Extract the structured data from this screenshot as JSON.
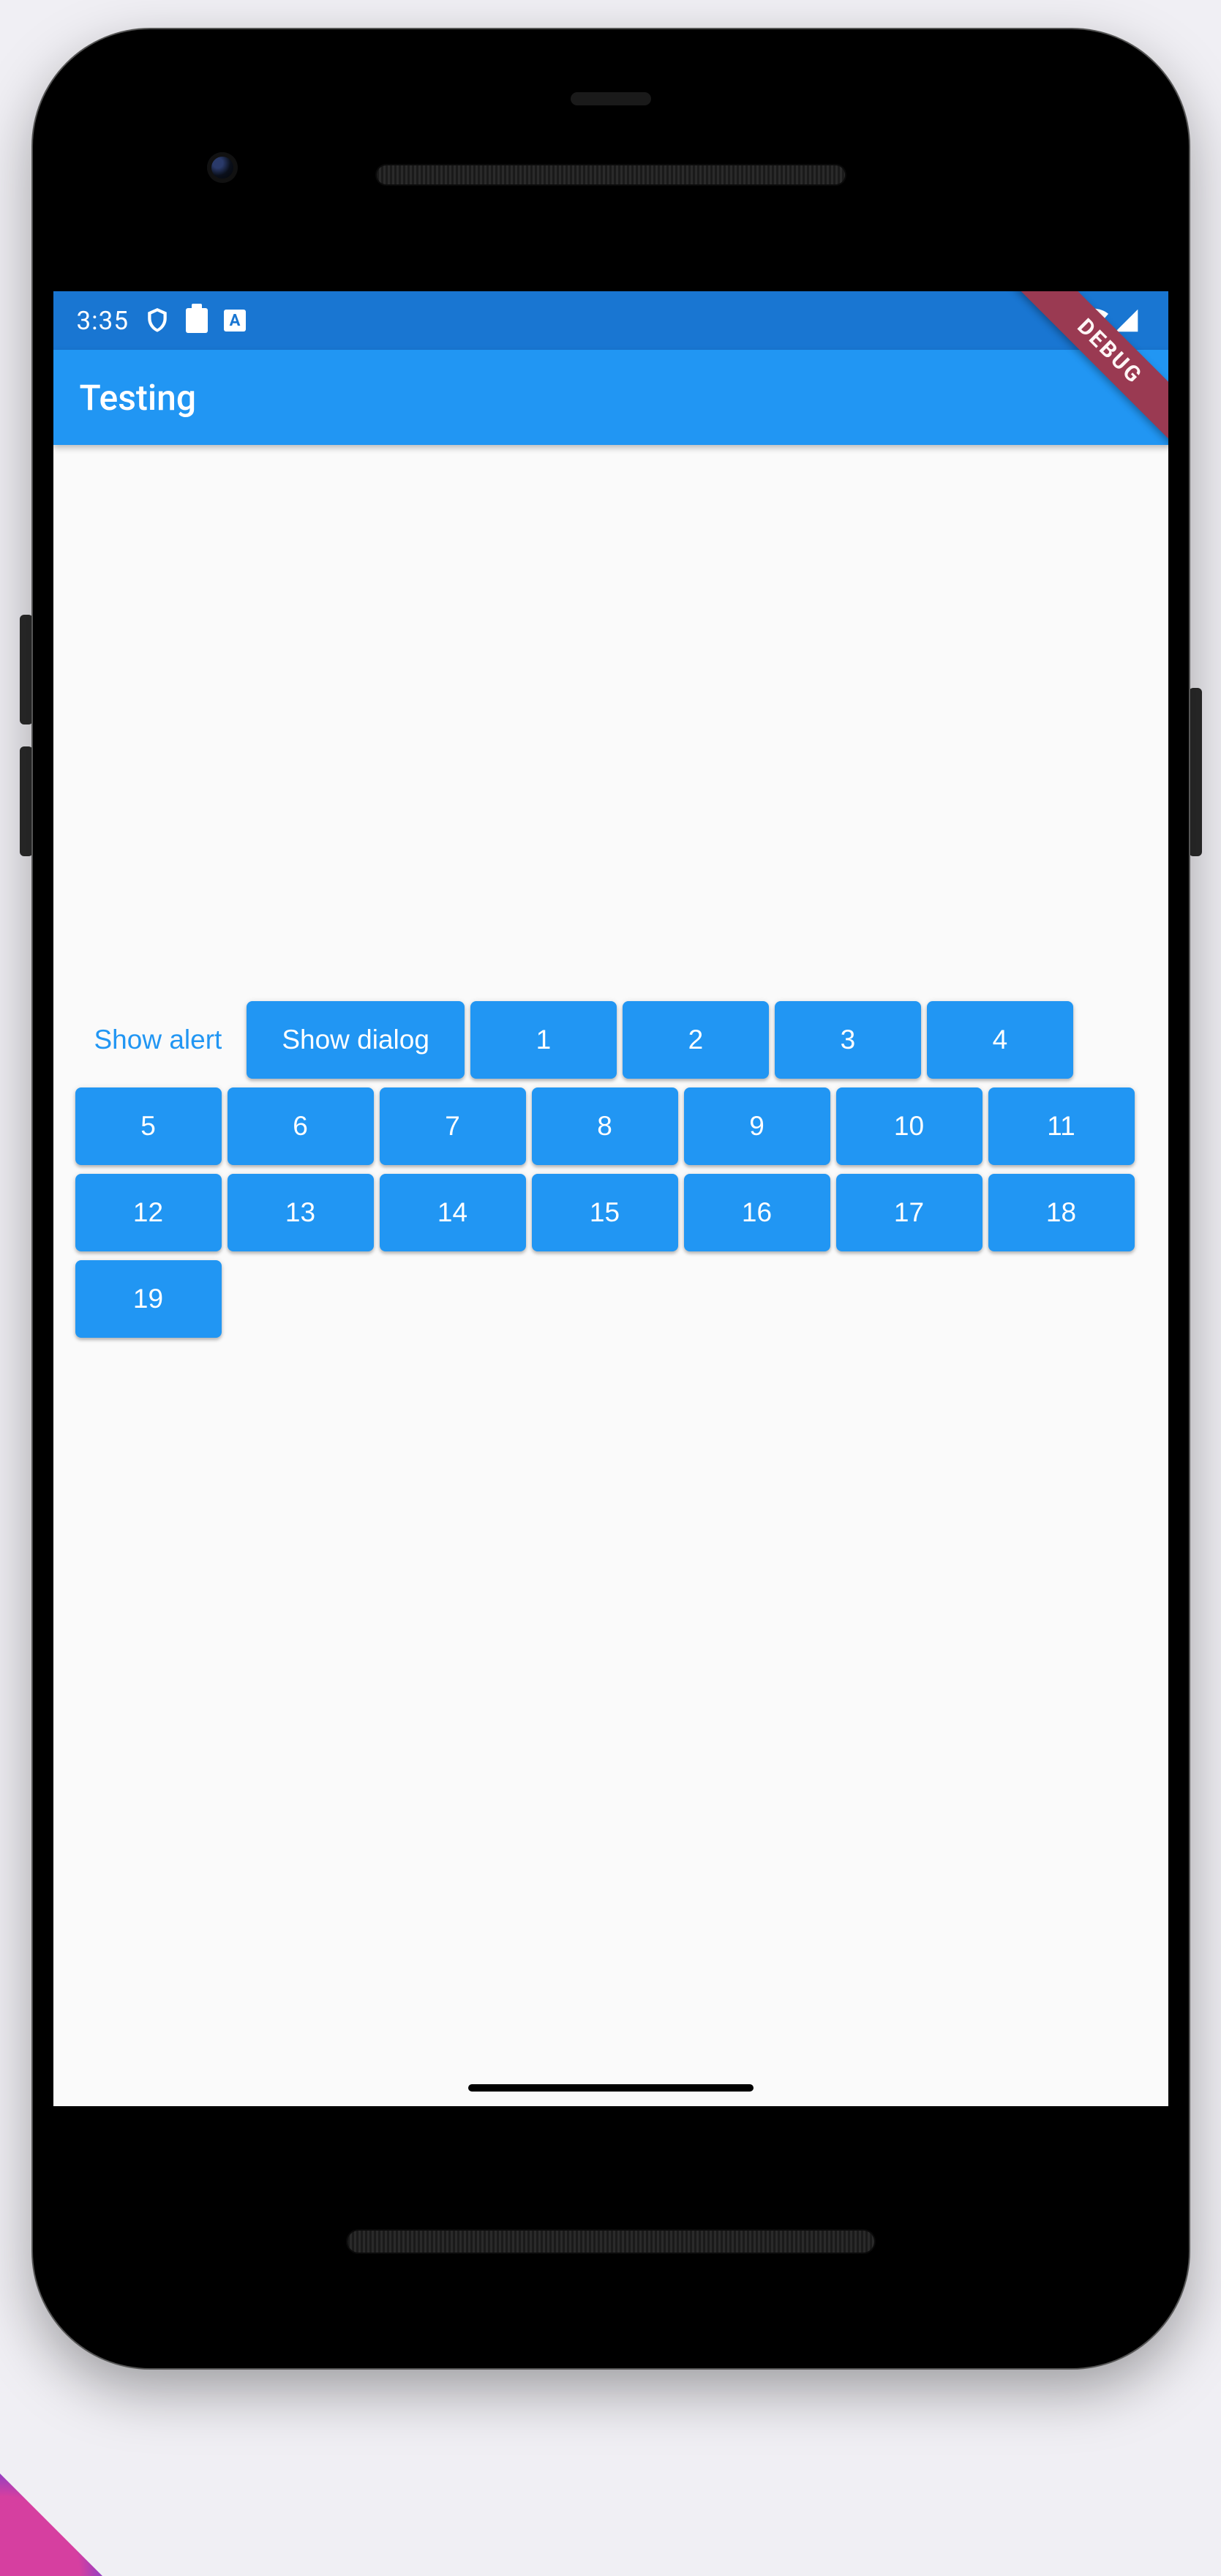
{
  "status": {
    "time": "3:35",
    "icons": [
      "shield-icon",
      "sd-card-icon",
      "a-badge-icon"
    ],
    "right_icons": [
      "wifi-icon",
      "cell-signal-icon"
    ]
  },
  "debug_ribbon": "DEBUG",
  "app_bar": {
    "title": "Testing"
  },
  "buttons": {
    "show_alert": "Show alert",
    "show_dialog": "Show dialog",
    "numbers": [
      "1",
      "2",
      "3",
      "4",
      "5",
      "6",
      "7",
      "8",
      "9",
      "10",
      "11",
      "12",
      "13",
      "14",
      "15",
      "16",
      "17",
      "18",
      "19"
    ]
  },
  "colors": {
    "primary": "#2196F3",
    "primary_dark": "#1976D2",
    "ribbon": "#9a3a52"
  }
}
